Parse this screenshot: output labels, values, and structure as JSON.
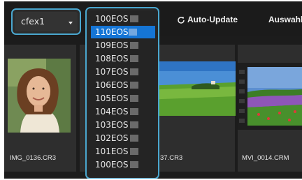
{
  "toolbar": {
    "card_label": "cfex1",
    "auto_update_label": "Auto-Update",
    "selection_label": "Auswahl"
  },
  "thumbnails": [
    {
      "filename": "IMG_0136.CR3"
    },
    {
      "filename": "37.CR3"
    },
    {
      "filename": "MVI_0014.CRM"
    }
  ],
  "folder_dropdown": {
    "selected_index": 1,
    "items": [
      "100EOS",
      "110EOS",
      "109EOS",
      "108EOS",
      "107EOS",
      "106EOS",
      "105EOS",
      "104EOS",
      "103EOS",
      "102EOS",
      "101EOS",
      "100EOS"
    ]
  },
  "colors": {
    "accent_outline": "#4aa7cf",
    "selection_highlight": "#1575d5",
    "background": "#1c1c1c"
  }
}
